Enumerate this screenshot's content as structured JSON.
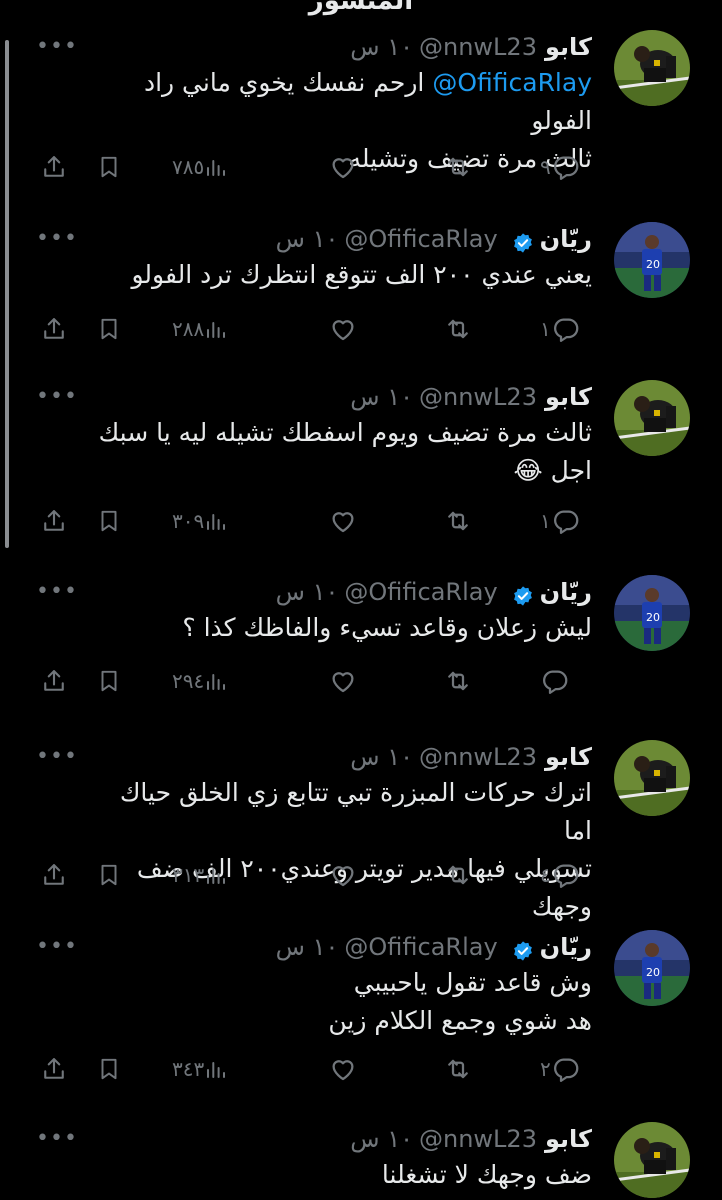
{
  "header": {
    "title": "المنشور"
  },
  "tweets": [
    {
      "name": "كابو",
      "handle": "@nnwL23",
      "time": "١٠ س",
      "verified": false,
      "mention": "@OfificaRlay",
      "lines": [
        "ارحم نفسك يخوي ماني راد الفولو",
        "ثالث مرة تضيف وتشيله"
      ],
      "replies": "٩",
      "views": "٧٨٥"
    },
    {
      "name": "ريّان",
      "handle": "@OfificaRlay",
      "time": "١٠ س",
      "verified": true,
      "lines": [
        "يعني عندي ٢٠٠ الف تتوقع انتظرك ترد الفولو"
      ],
      "replies": "١",
      "views": "٢٨٨"
    },
    {
      "name": "كابو",
      "handle": "@nnwL23",
      "time": "١٠ س",
      "verified": false,
      "lines": [
        "ثالث مرة تضيف ويوم اسفطك تشيله ليه يا سبك",
        "اجل 😂"
      ],
      "replies": "١",
      "views": "٣٠٩"
    },
    {
      "name": "ريّان",
      "handle": "@OfificaRlay",
      "time": "١٠ س",
      "verified": true,
      "lines": [
        "ليش زعلان وقاعد تسيء والفاظك كذا ؟"
      ],
      "replies": "",
      "views": "٢٩٤"
    },
    {
      "name": "كابو",
      "handle": "@nnwL23",
      "time": "١٠ س",
      "verified": false,
      "lines": [
        "اترك حركات المبزرة تبي تتابع زي الخلق حياك اما",
        "تسويلي فيها مدير تويتر وعندي٢٠٠ الف ضف وجهك"
      ],
      "replies": "٤",
      "views": "٣١٣"
    },
    {
      "name": "ريّان",
      "handle": "@OfificaRlay",
      "time": "١٠ س",
      "verified": true,
      "lines": [
        "وش قاعد تقول ياحبيبي",
        "هد شوي وجمع الكلام زين"
      ],
      "replies": "٢",
      "views": "٣٤٣"
    },
    {
      "name": "كابو",
      "handle": "@nnwL23",
      "time": "١٠ س",
      "verified": false,
      "lines": [
        "ضف وجهك لا تشغلنا"
      ],
      "replies": "",
      "views": ""
    }
  ],
  "colors": {
    "background": "#000000",
    "text": "#e7e9ea",
    "muted": "#71767b",
    "accent": "#1d9bf0"
  },
  "icons": [
    "more-icon",
    "verified-icon",
    "reply-icon",
    "retweet-icon",
    "like-icon",
    "views-icon",
    "bookmark-icon",
    "share-icon"
  ]
}
